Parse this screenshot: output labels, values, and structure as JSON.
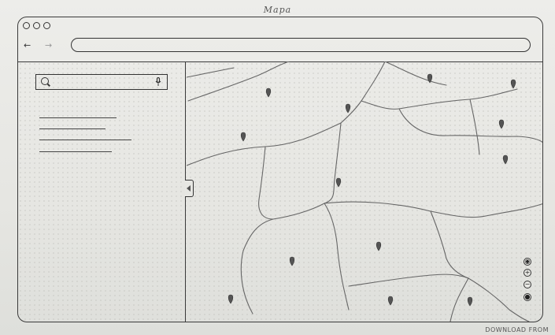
{
  "page": {
    "title": "Mapa"
  },
  "browser": {
    "back_icon": "arrow-left-icon",
    "forward_icon": "arrow-right-icon",
    "address": {
      "value": "",
      "placeholder": ""
    }
  },
  "sidebar": {
    "search": {
      "value": "",
      "placeholder": "",
      "icon": "search-icon",
      "mic_icon": "microphone-icon"
    }
  },
  "map": {
    "controls": [
      {
        "name": "location-icon",
        "glyph": "◉"
      },
      {
        "name": "zoom-in-icon",
        "glyph": "+"
      },
      {
        "name": "zoom-out-icon",
        "glyph": "−"
      },
      {
        "name": "person-icon",
        "glyph": "●"
      }
    ]
  },
  "watermark": "DOWNLOAD FROM"
}
